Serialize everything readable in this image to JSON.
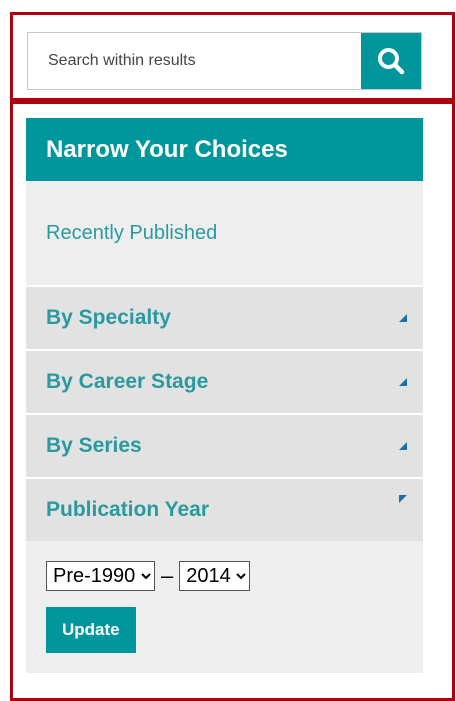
{
  "search": {
    "placeholder": "Search within results"
  },
  "panel": {
    "title": "Narrow Your Choices",
    "recent_link": "Recently Published",
    "facets": [
      {
        "label": "By Specialty",
        "state": "collapsed"
      },
      {
        "label": "By Career Stage",
        "state": "collapsed"
      },
      {
        "label": "By Series",
        "state": "collapsed"
      },
      {
        "label": "Publication Year",
        "state": "expanded"
      }
    ],
    "year": {
      "from": "Pre-1990",
      "separator": "–",
      "to": "2014",
      "update_label": "Update"
    }
  },
  "colors": {
    "accent": "#00969c",
    "frame": "#b00010",
    "panel_bg": "#eeeeee",
    "facet_bg": "#e2e2e2",
    "link_text": "#2a9aa0"
  },
  "icons": {
    "search_button": "search-icon",
    "collapsed_facet": "triangle-up-icon",
    "expanded_facet": "triangle-down-icon"
  }
}
